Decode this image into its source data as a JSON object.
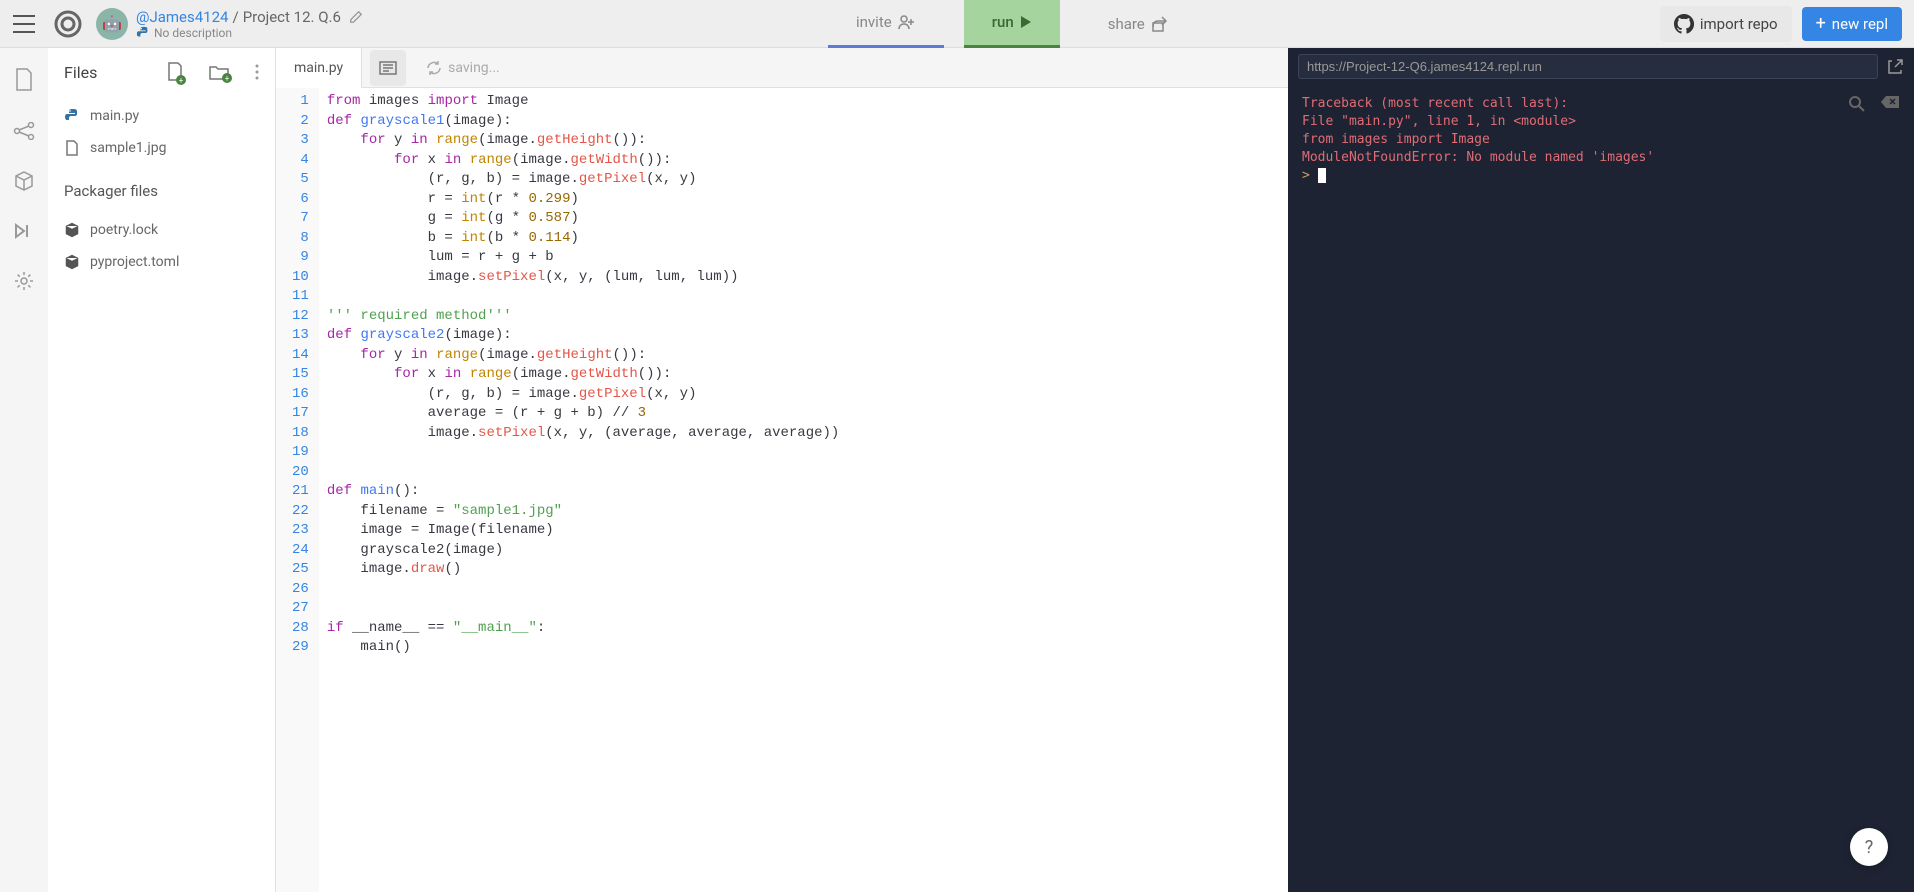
{
  "header": {
    "user": "@James4124",
    "project": "Project 12. Q.6",
    "description": "No description",
    "invite_label": "invite",
    "run_label": "run",
    "share_label": "share",
    "import_label": "import repo",
    "newrepl_label": "new repl"
  },
  "sidebar": {
    "title": "Files",
    "files": [
      {
        "name": "main.py",
        "icon": "python"
      },
      {
        "name": "sample1.jpg",
        "icon": "file"
      }
    ],
    "packager_title": "Packager files",
    "packager_files": [
      {
        "name": "poetry.lock",
        "icon": "cube"
      },
      {
        "name": "pyproject.toml",
        "icon": "cube"
      }
    ]
  },
  "editor": {
    "tab": "main.py",
    "saving": "saving...",
    "lines": 29,
    "code_lines": [
      {
        "n": 1,
        "html": "<span class='kw'>from</span> images <span class='kw'>import</span> Image"
      },
      {
        "n": 2,
        "html": "<span class='kw'>def</span> <span class='fn'>grayscale1</span>(image):"
      },
      {
        "n": 3,
        "html": "    <span class='kw'>for</span> y <span class='kw'>in</span> <span class='builtin'>range</span>(image.<span class='attr'>getHeight</span>()):"
      },
      {
        "n": 4,
        "html": "        <span class='kw'>for</span> x <span class='kw'>in</span> <span class='builtin'>range</span>(image.<span class='attr'>getWidth</span>()):"
      },
      {
        "n": 5,
        "html": "            (r, g, b) = image.<span class='attr'>getPixel</span>(x, y)"
      },
      {
        "n": 6,
        "html": "            r = <span class='builtin'>int</span>(r * <span class='num'>0.299</span>)"
      },
      {
        "n": 7,
        "html": "            g = <span class='builtin'>int</span>(g * <span class='num'>0.587</span>)"
      },
      {
        "n": 8,
        "html": "            b = <span class='builtin'>int</span>(b * <span class='num'>0.114</span>)"
      },
      {
        "n": 9,
        "html": "            lum = r + g + b"
      },
      {
        "n": 10,
        "html": "            image.<span class='attr'>setPixel</span>(x, y, (lum, lum, lum))"
      },
      {
        "n": 11,
        "html": ""
      },
      {
        "n": 12,
        "html": "<span class='cmt'>''' required method'''</span>"
      },
      {
        "n": 13,
        "html": "<span class='kw'>def</span> <span class='fn'>grayscale2</span>(image):"
      },
      {
        "n": 14,
        "html": "    <span class='kw'>for</span> y <span class='kw'>in</span> <span class='builtin'>range</span>(image.<span class='attr'>getHeight</span>()):"
      },
      {
        "n": 15,
        "html": "        <span class='kw'>for</span> x <span class='kw'>in</span> <span class='builtin'>range</span>(image.<span class='attr'>getWidth</span>()):"
      },
      {
        "n": 16,
        "html": "            (r, g, b) = image.<span class='attr'>getPixel</span>(x, y)"
      },
      {
        "n": 17,
        "html": "            average = (r + g + b) // <span class='num'>3</span>"
      },
      {
        "n": 18,
        "html": "            image.<span class='attr'>setPixel</span>(x, y, (average, average, average))"
      },
      {
        "n": 19,
        "html": ""
      },
      {
        "n": 20,
        "html": ""
      },
      {
        "n": 21,
        "html": "<span class='kw'>def</span> <span class='fn'>main</span>():"
      },
      {
        "n": 22,
        "html": "    filename = <span class='str'>\"sample1.jpg\"</span>"
      },
      {
        "n": 23,
        "html": "    image = Image(filename)"
      },
      {
        "n": 24,
        "html": "    grayscale2(image)"
      },
      {
        "n": 25,
        "html": "    image.<span class='attr'>draw</span>()"
      },
      {
        "n": 26,
        "html": ""
      },
      {
        "n": 27,
        "html": ""
      },
      {
        "n": 28,
        "html": "<span class='kw'>if</span> __name__ == <span class='str'>\"__main__\"</span>:"
      },
      {
        "n": 29,
        "html": "    main()"
      }
    ]
  },
  "console": {
    "url": "https://Project-12-Q6.james4124.repl.run",
    "output": [
      "Traceback (most recent call last):",
      "  File \"main.py\", line 1, in <module>",
      "    from images import Image",
      "ModuleNotFoundError: No module named 'images'"
    ],
    "prompt": ">"
  },
  "help": "?"
}
